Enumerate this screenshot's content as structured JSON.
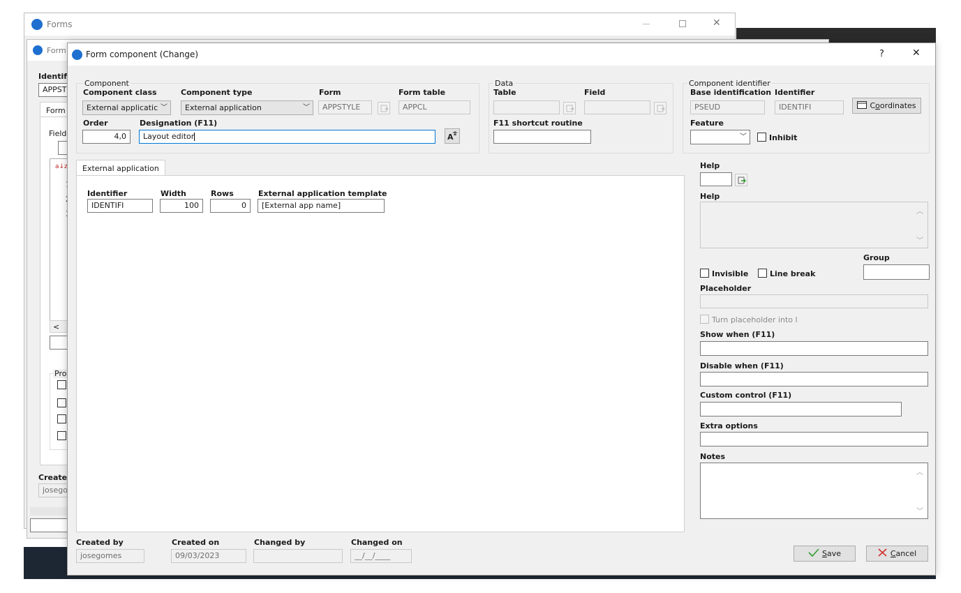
{
  "back_window": {
    "title": "Forms",
    "form_title": "Form",
    "identifier_label": "Identifi",
    "identifier_value": "APPST",
    "tab_form": "Form",
    "fields_label": "Field",
    "props_label": "Pro",
    "created_label": "Created",
    "created_value": "josego",
    "sort_icon_text": "a↓z",
    "row_1": "1",
    "row_2": "2",
    "row_3": "3",
    "scroll_left": "<"
  },
  "dialog": {
    "title": "Form component (Change)",
    "help_glyph": "?",
    "close_glyph": "✕",
    "component": {
      "group_title": "Component",
      "class_label": "Component class",
      "class_value": "External applicatic",
      "type_label": "Component type",
      "type_value": "External application",
      "form_label": "Form",
      "form_value": "APPSTYLE",
      "form_table_label": "Form table",
      "form_table_value": "APPCL",
      "order_label": "Order",
      "order_value": "4,0",
      "designation_label": "Designation (F11)",
      "designation_value": "Layout editor"
    },
    "data_group": {
      "group_title": "Data",
      "table_label": "Table",
      "table_value": "",
      "field_label": "Field",
      "field_value": "",
      "f11_label": "F11 shortcut routine",
      "f11_value": ""
    },
    "identifier_group": {
      "group_title": "Component identifier",
      "base_label": "Base identification",
      "base_value": "PSEUD",
      "identifier_label": "Identifier",
      "identifier_value": "IDENTIFI",
      "coords_prefix": "C",
      "coords_underlined": "o",
      "coords_suffix": "ordinates",
      "feature_label": "Feature",
      "feature_value": "",
      "inhibit_label": "Inhibit"
    },
    "tab": {
      "label": "External application",
      "identifier_label": "Identifier",
      "identifier_value": "IDENTIFI",
      "width_label": "Width",
      "width_value": "100",
      "rows_label": "Rows",
      "rows_value": "0",
      "template_label": "External application template",
      "template_value": "[External app name]"
    },
    "right_panel": {
      "help_code_label": "Help",
      "help_code_value": "",
      "help_text_label": "Help",
      "group_label": "Group",
      "group_value": "",
      "invisible_label": "Invisible",
      "line_break_label": "Line break",
      "placeholder_label": "Placeholder",
      "placeholder_value": "",
      "turn_placeholder_label": "Turn placeholder into l",
      "show_when_label": "Show when (F11)",
      "show_when_value": "",
      "disable_when_label": "Disable when (F11)",
      "disable_when_value": "",
      "custom_control_label": "Custom control (F11)",
      "custom_control_value": "",
      "extra_options_label": "Extra options",
      "extra_options_value": "",
      "notes_label": "Notes"
    },
    "footer": {
      "created_by_label": "Created by",
      "created_by_value": "josegomes",
      "created_on_label": "Created on",
      "created_on_value": "09/03/2023",
      "changed_by_label": "Changed by",
      "changed_by_value": "",
      "changed_on_label": "Changed on",
      "changed_on_value": "__/__/____",
      "save_underlined": "S",
      "save_suffix": "ave",
      "cancel_underlined": "C",
      "cancel_suffix": "ancel"
    }
  },
  "colors": {
    "dialog_bg": "#f0f0f0",
    "focus_border": "#0078d7",
    "save_check": "#2e9e2e",
    "cancel_x": "#d32f2f",
    "taskbar": "#1d2733"
  }
}
